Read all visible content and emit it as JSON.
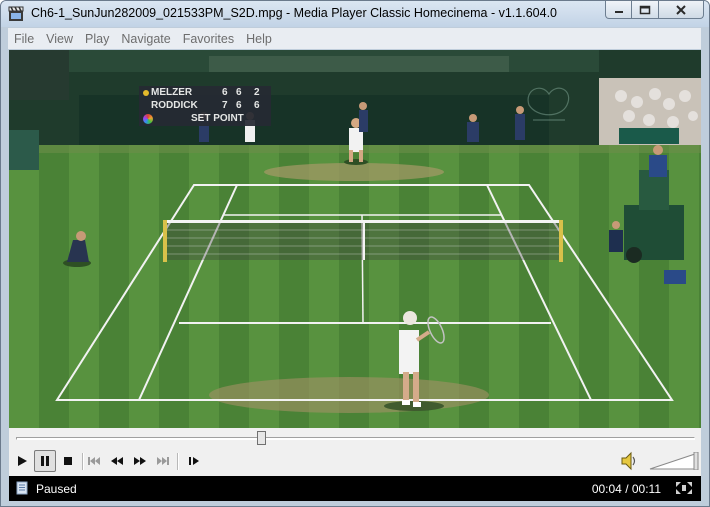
{
  "window": {
    "title": "Ch6-1_SunJun282009_021533PM_S2D.mpg - Media Player Classic Homecinema - v1.1.604.0"
  },
  "menu": [
    "File",
    "View",
    "Play",
    "Navigate",
    "Favorites",
    "Help"
  ],
  "scoreboard": {
    "rows": [
      {
        "name": "MELZER",
        "s1": "6",
        "s2": "6",
        "s3": "2",
        "serving": true
      },
      {
        "name": "RODDICK",
        "s1": "7",
        "s2": "6",
        "s3": "6",
        "serving": false
      }
    ],
    "status": "SET POINT"
  },
  "controls": {
    "seek_position": 0.36,
    "volume_level": 1.0
  },
  "status": {
    "state": "Paused",
    "time": "00:04 / 00:11"
  },
  "colors": {
    "grass": "#4f8a3a",
    "scoreboard_bg": "#2b2f3a",
    "scoreboard_accent": "#f2c32c"
  }
}
